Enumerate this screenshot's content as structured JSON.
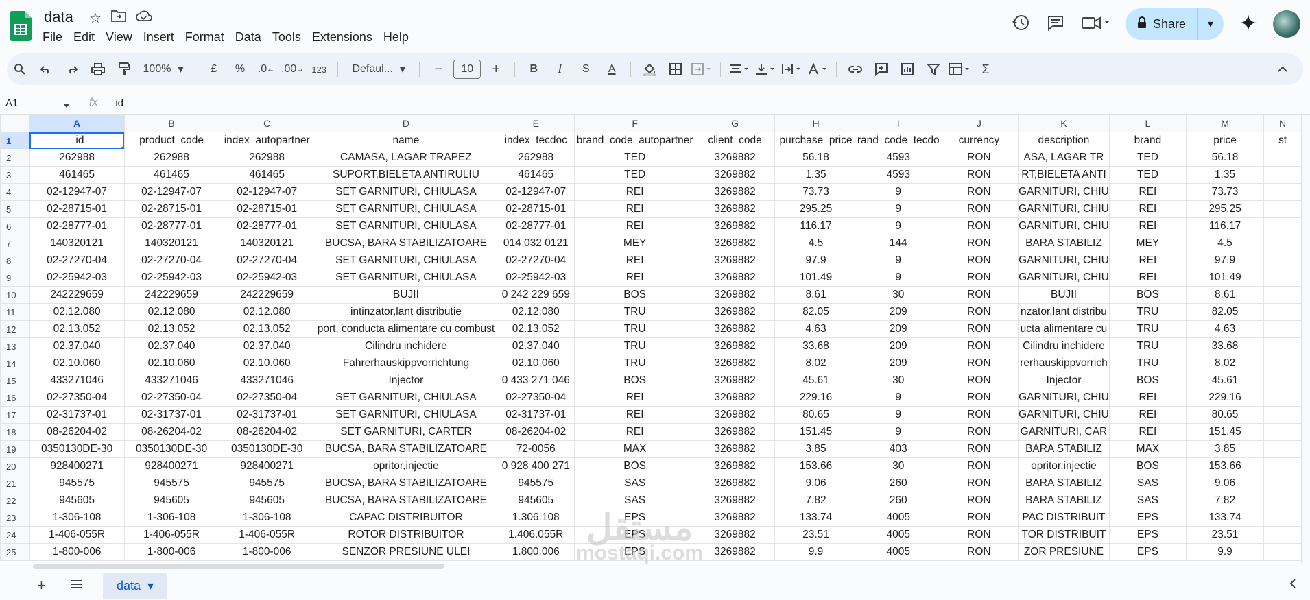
{
  "app": {
    "title": "data",
    "menus": [
      "File",
      "Edit",
      "View",
      "Insert",
      "Format",
      "Data",
      "Tools",
      "Extensions",
      "Help"
    ],
    "share_label": "Share"
  },
  "toolbar": {
    "zoom": "100%",
    "currency": "£",
    "percent": "%",
    "dec_less": ".0",
    "dec_more": ".00",
    "number_format": "123",
    "font": "Defaul...",
    "font_size": "10",
    "minus": "−",
    "plus": "+",
    "bold": "B",
    "italic": "I",
    "strike": "S",
    "textcolor": "A",
    "sum": "Σ"
  },
  "formula_bar": {
    "cell_ref": "A1",
    "fx": "fx",
    "value": "_id"
  },
  "grid": {
    "columns": [
      "A",
      "B",
      "C",
      "D",
      "E",
      "F",
      "G",
      "H",
      "I",
      "J",
      "K",
      "L",
      "M",
      "N"
    ],
    "rows": [
      [
        "_id",
        "product_code",
        "index_autopartner",
        "name",
        "index_tecdoc",
        "brand_code_autopartner",
        "client_code",
        "purchase_price",
        "rand_code_tecdo",
        "currency",
        "description",
        "brand",
        "price",
        "st"
      ],
      [
        "262988",
        "262988",
        "262988",
        "CAMASA, LAGAR TRAPEZ",
        "262988",
        "TED",
        "3269882",
        "56.18",
        "4593",
        "RON",
        "ASA, LAGAR TR",
        "TED",
        "56.18",
        ""
      ],
      [
        "461465",
        "461465",
        "461465",
        "SUPORT,BIELETA ANTIRULIU",
        "461465",
        "TED",
        "3269882",
        "1.35",
        "4593",
        "RON",
        "RT,BIELETA ANTI",
        "TED",
        "1.35",
        ""
      ],
      [
        "02-12947-07",
        "02-12947-07",
        "02-12947-07",
        "SET GARNITURI, CHIULASA",
        "02-12947-07",
        "REI",
        "3269882",
        "73.73",
        "9",
        "RON",
        "GARNITURI, CHIU",
        "REI",
        "73.73",
        ""
      ],
      [
        "02-28715-01",
        "02-28715-01",
        "02-28715-01",
        "SET GARNITURI, CHIULASA",
        "02-28715-01",
        "REI",
        "3269882",
        "295.25",
        "9",
        "RON",
        "GARNITURI, CHIU",
        "REI",
        "295.25",
        ""
      ],
      [
        "02-28777-01",
        "02-28777-01",
        "02-28777-01",
        "SET GARNITURI, CHIULASA",
        "02-28777-01",
        "REI",
        "3269882",
        "116.17",
        "9",
        "RON",
        "GARNITURI, CHIU",
        "REI",
        "116.17",
        ""
      ],
      [
        "140320121",
        "140320121",
        "140320121",
        "BUCSA, BARA STABILIZATOARE",
        "014 032 0121",
        "MEY",
        "3269882",
        "4.5",
        "144",
        "RON",
        " BARA STABILIZ",
        "MEY",
        "4.5",
        ""
      ],
      [
        "02-27270-04",
        "02-27270-04",
        "02-27270-04",
        "SET GARNITURI, CHIULASA",
        "02-27270-04",
        "REI",
        "3269882",
        "97.9",
        "9",
        "RON",
        "GARNITURI, CHIU",
        "REI",
        "97.9",
        ""
      ],
      [
        "02-25942-03",
        "02-25942-03",
        "02-25942-03",
        "SET GARNITURI, CHIULASA",
        "02-25942-03",
        "REI",
        "3269882",
        "101.49",
        "9",
        "RON",
        "GARNITURI, CHIU",
        "REI",
        "101.49",
        ""
      ],
      [
        "242229659",
        "242229659",
        "242229659",
        "BUJII",
        "0 242 229 659",
        "BOS",
        "3269882",
        "8.61",
        "30",
        "RON",
        "BUJII",
        "BOS",
        "8.61",
        ""
      ],
      [
        "02.12.080",
        "02.12.080",
        "02.12.080",
        "intinzator,lant distributie",
        "02.12.080",
        "TRU",
        "3269882",
        "82.05",
        "209",
        "RON",
        "nzator,lant distribu",
        "TRU",
        "82.05",
        ""
      ],
      [
        "02.13.052",
        "02.13.052",
        "02.13.052",
        "port, conducta alimentare cu combust",
        "02.13.052",
        "TRU",
        "3269882",
        "4.63",
        "209",
        "RON",
        "ucta alimentare cu",
        "TRU",
        "4.63",
        ""
      ],
      [
        "02.37.040",
        "02.37.040",
        "02.37.040",
        "Cilindru inchidere",
        "02.37.040",
        "TRU",
        "3269882",
        "33.68",
        "209",
        "RON",
        "Cilindru inchidere",
        "TRU",
        "33.68",
        ""
      ],
      [
        "02.10.060",
        "02.10.060",
        "02.10.060",
        "Fahrerhauskippvorrichtung",
        "02.10.060",
        "TRU",
        "3269882",
        "8.02",
        "209",
        "RON",
        "rerhauskippvorrich",
        "TRU",
        "8.02",
        ""
      ],
      [
        "433271046",
        "433271046",
        "433271046",
        "Injector",
        "0 433 271 046",
        "BOS",
        "3269882",
        "45.61",
        "30",
        "RON",
        "Injector",
        "BOS",
        "45.61",
        ""
      ],
      [
        "02-27350-04",
        "02-27350-04",
        "02-27350-04",
        "SET GARNITURI, CHIULASA",
        "02-27350-04",
        "REI",
        "3269882",
        "229.16",
        "9",
        "RON",
        "GARNITURI, CHIU",
        "REI",
        "229.16",
        ""
      ],
      [
        "02-31737-01",
        "02-31737-01",
        "02-31737-01",
        "SET GARNITURI, CHIULASA",
        "02-31737-01",
        "REI",
        "3269882",
        "80.65",
        "9",
        "RON",
        "GARNITURI, CHIU",
        "REI",
        "80.65",
        ""
      ],
      [
        "08-26204-02",
        "08-26204-02",
        "08-26204-02",
        "SET GARNITURI, CARTER",
        "08-26204-02",
        "REI",
        "3269882",
        "151.45",
        "9",
        "RON",
        "GARNITURI, CAR",
        "REI",
        "151.45",
        ""
      ],
      [
        "0350130DE-30",
        "0350130DE-30",
        "0350130DE-30",
        "BUCSA, BARA STABILIZATOARE",
        "72-0056",
        "MAX",
        "3269882",
        "3.85",
        "403",
        "RON",
        " BARA STABILIZ",
        "MAX",
        "3.85",
        ""
      ],
      [
        "928400271",
        "928400271",
        "928400271",
        "opritor,injectie",
        "0 928 400 271",
        "BOS",
        "3269882",
        "153.66",
        "30",
        "RON",
        "opritor,injectie",
        "BOS",
        "153.66",
        ""
      ],
      [
        "945575",
        "945575",
        "945575",
        "BUCSA, BARA STABILIZATOARE",
        "945575",
        "SAS",
        "3269882",
        "9.06",
        "260",
        "RON",
        " BARA STABILIZ",
        "SAS",
        "9.06",
        ""
      ],
      [
        "945605",
        "945605",
        "945605",
        "BUCSA, BARA STABILIZATOARE",
        "945605",
        "SAS",
        "3269882",
        "7.82",
        "260",
        "RON",
        " BARA STABILIZ",
        "SAS",
        "7.82",
        ""
      ],
      [
        "1-306-108",
        "1-306-108",
        "1-306-108",
        "CAPAC DISTRIBUITOR",
        "1.306.108",
        "EPS",
        "3269882",
        "133.74",
        "4005",
        "RON",
        "PAC DISTRIBUIT",
        "EPS",
        "133.74",
        ""
      ],
      [
        "1-406-055R",
        "1-406-055R",
        "1-406-055R",
        "ROTOR DISTRIBUITOR",
        "1.406.055R",
        "EPS",
        "3269882",
        "23.51",
        "4005",
        "RON",
        "TOR DISTRIBUIT",
        "EPS",
        "23.51",
        ""
      ],
      [
        "1-800-006",
        "1-800-006",
        "1-800-006",
        "SENZOR PRESIUNE ULEI",
        "1.800.006",
        "EPS",
        "3269882",
        "9.9",
        "4005",
        "RON",
        "ZOR PRESIUNE",
        "EPS",
        "9.9",
        ""
      ]
    ]
  },
  "sheets": {
    "add": "+",
    "active": "data"
  },
  "watermark": {
    "arabic": "مستقل",
    "latin": "mostaqi.com"
  }
}
